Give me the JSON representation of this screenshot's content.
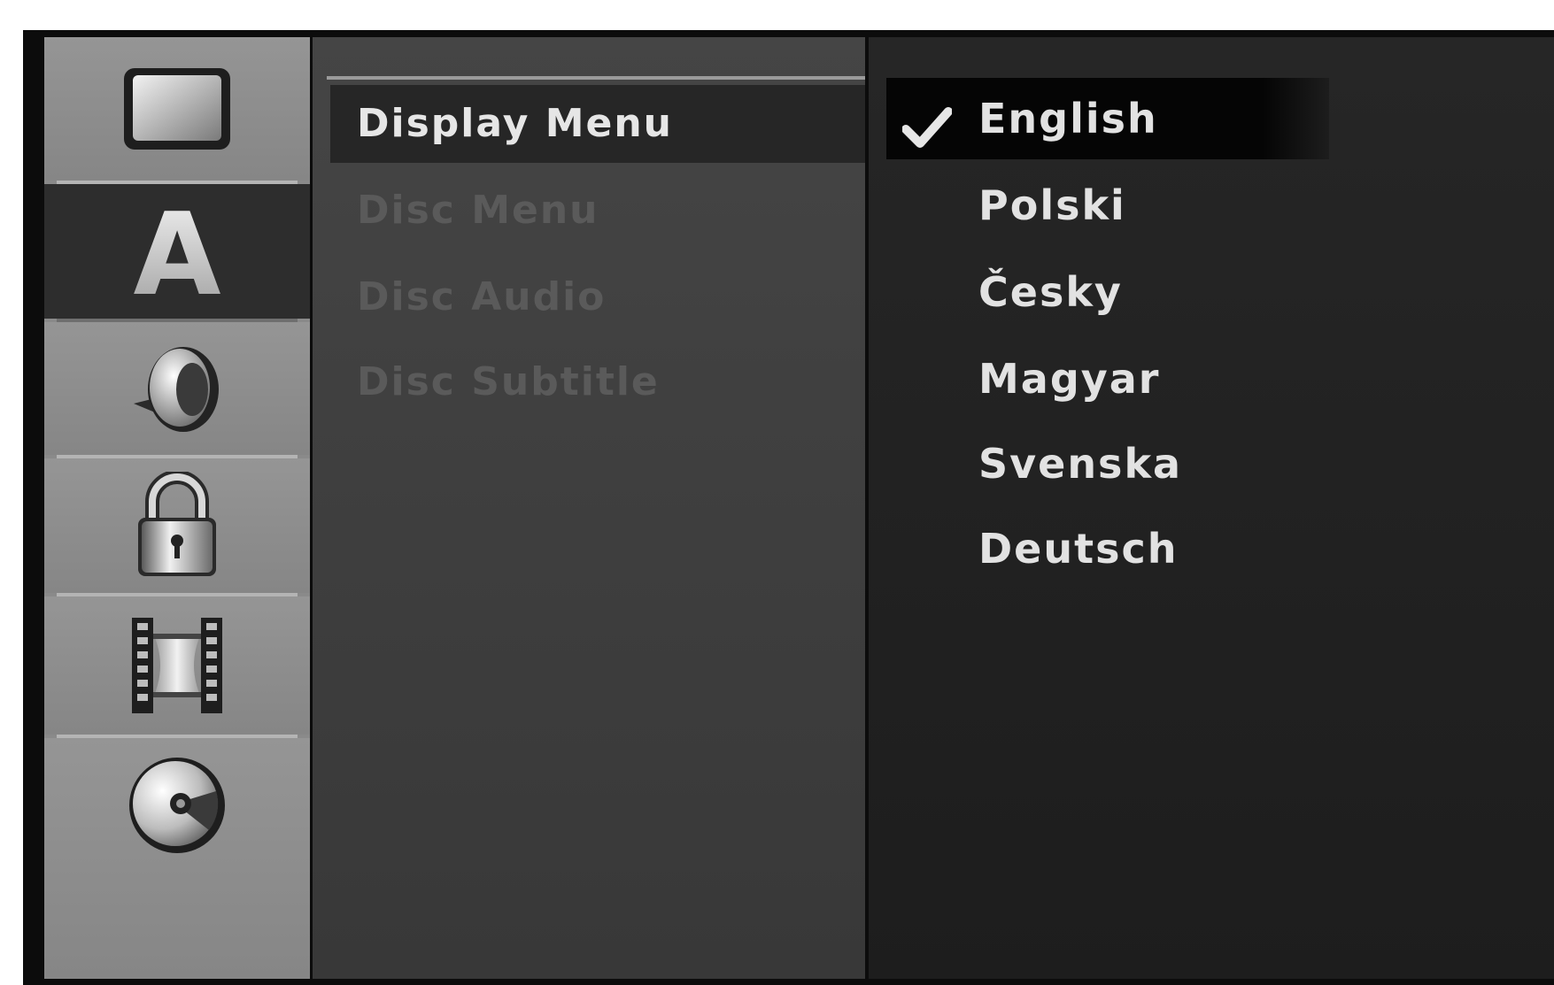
{
  "sidebar": {
    "items": [
      {
        "icon": "tv-screen-icon"
      },
      {
        "icon": "letter-a-icon",
        "glyph": "A",
        "selected": true
      },
      {
        "icon": "speaker-icon"
      },
      {
        "icon": "padlock-icon"
      },
      {
        "icon": "film-strip-icon"
      },
      {
        "icon": "disc-icon"
      }
    ]
  },
  "menu": {
    "items": [
      {
        "label": "Display Menu",
        "active": true
      },
      {
        "label": "Disc Menu",
        "active": false
      },
      {
        "label": "Disc Audio",
        "active": false
      },
      {
        "label": "Disc Subtitle",
        "active": false
      }
    ]
  },
  "languages": {
    "selected": "English",
    "options": [
      {
        "label": "English"
      },
      {
        "label": "Polski"
      },
      {
        "label": "Česky"
      },
      {
        "label": "Magyar"
      },
      {
        "label": "Svenska"
      },
      {
        "label": "Deutsch"
      }
    ]
  },
  "colors": {
    "sidebar_bg": "#8a8a8a",
    "selected_bg": "#2d2d2d",
    "menu_bg": "#404040",
    "lang_bg": "#222222",
    "text_active": "#e6e6e6",
    "text_dim": "#5a5a5a"
  }
}
